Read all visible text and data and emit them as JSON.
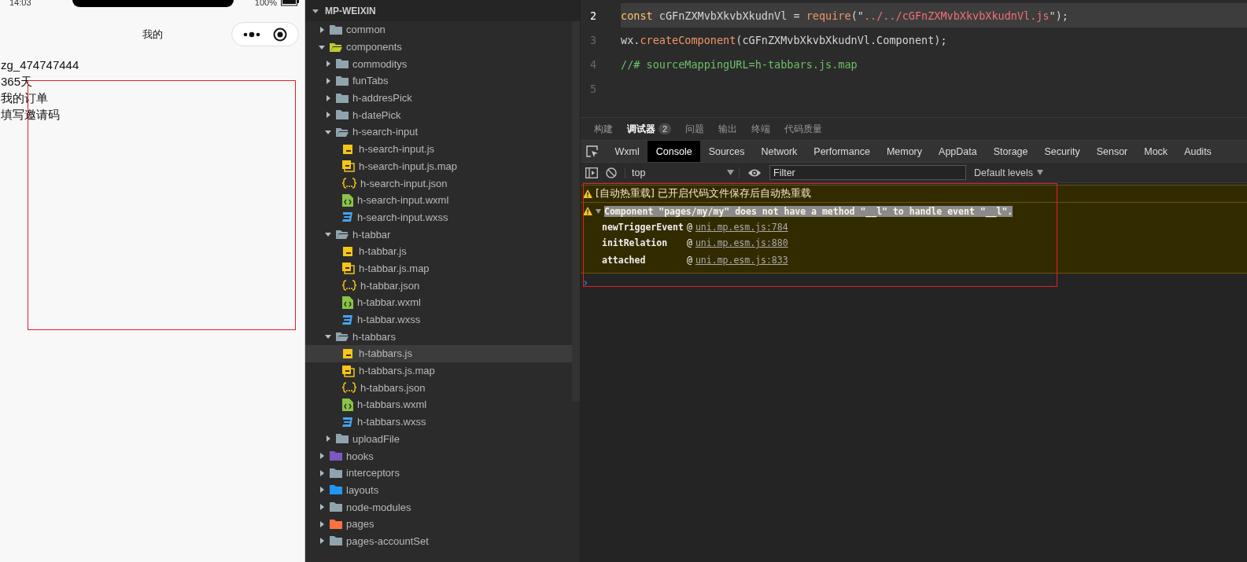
{
  "phone": {
    "status_bar": {
      "time": "14:03",
      "battery": "100%"
    },
    "nav_title": "我的",
    "lines": [
      "zg_474747444",
      "365天",
      "我的订单",
      "填写邀请码"
    ]
  },
  "explorer": {
    "title": "MP-WEIXIN",
    "expanded": true,
    "children": [
      {
        "name": "common",
        "kind": "folder",
        "color": "#90a4ae",
        "expanded": false,
        "selected": false
      },
      {
        "name": "components",
        "kind": "folder",
        "color": "#c0ca33",
        "expanded": true,
        "selected": false,
        "children": [
          {
            "name": "commoditys",
            "kind": "folder",
            "color": "#90a4ae",
            "expanded": false,
            "selected": false
          },
          {
            "name": "funTabs",
            "kind": "folder",
            "color": "#90a4ae",
            "expanded": false,
            "selected": false
          },
          {
            "name": "h-addresPick",
            "kind": "folder",
            "color": "#90a4ae",
            "expanded": false,
            "selected": false
          },
          {
            "name": "h-datePick",
            "kind": "folder",
            "color": "#90a4ae",
            "expanded": false,
            "selected": false
          },
          {
            "name": "h-search-input",
            "kind": "folder",
            "color": "#90a4ae",
            "expanded": true,
            "selected": false,
            "children": [
              {
                "name": "h-search-input.js",
                "kind": "js",
                "selected": false
              },
              {
                "name": "h-search-input.js.map",
                "kind": "map",
                "selected": false
              },
              {
                "name": "h-search-input.json",
                "kind": "json",
                "selected": false
              },
              {
                "name": "h-search-input.wxml",
                "kind": "wxml",
                "selected": false
              },
              {
                "name": "h-search-input.wxss",
                "kind": "wxss",
                "selected": false
              }
            ]
          },
          {
            "name": "h-tabbar",
            "kind": "folder",
            "color": "#90a4ae",
            "expanded": true,
            "selected": false,
            "children": [
              {
                "name": "h-tabbar.js",
                "kind": "js",
                "selected": false
              },
              {
                "name": "h-tabbar.js.map",
                "kind": "map",
                "selected": false
              },
              {
                "name": "h-tabbar.json",
                "kind": "json",
                "selected": false
              },
              {
                "name": "h-tabbar.wxml",
                "kind": "wxml",
                "selected": false
              },
              {
                "name": "h-tabbar.wxss",
                "kind": "wxss",
                "selected": false
              }
            ]
          },
          {
            "name": "h-tabbars",
            "kind": "folder",
            "color": "#90a4ae",
            "expanded": true,
            "selected": false,
            "children": [
              {
                "name": "h-tabbars.js",
                "kind": "js",
                "selected": true
              },
              {
                "name": "h-tabbars.js.map",
                "kind": "map",
                "selected": false
              },
              {
                "name": "h-tabbars.json",
                "kind": "json",
                "selected": false
              },
              {
                "name": "h-tabbars.wxml",
                "kind": "wxml",
                "selected": false
              },
              {
                "name": "h-tabbars.wxss",
                "kind": "wxss",
                "selected": false
              }
            ]
          },
          {
            "name": "uploadFile",
            "kind": "folder",
            "color": "#90a4ae",
            "expanded": false,
            "selected": false
          }
        ]
      },
      {
        "name": "hooks",
        "kind": "folder",
        "color": "#7e57c2",
        "expanded": false,
        "selected": false
      },
      {
        "name": "interceptors",
        "kind": "folder",
        "color": "#90a4ae",
        "expanded": false,
        "selected": false
      },
      {
        "name": "layouts",
        "kind": "folder",
        "color": "#2196f3",
        "expanded": false,
        "selected": false
      },
      {
        "name": "node-modules",
        "kind": "folder",
        "color": "#90a4ae",
        "expanded": false,
        "selected": false
      },
      {
        "name": "pages",
        "kind": "folder",
        "color": "#ff7043",
        "expanded": false,
        "selected": false
      },
      {
        "name": "pages-accountSet",
        "kind": "folder",
        "color": "#90a4ae",
        "expanded": false,
        "selected": false
      }
    ]
  },
  "editor": {
    "lines": [
      {
        "number": "2",
        "current": true,
        "tokens": [
          {
            "kind": "keyword",
            "text": "const"
          },
          {
            "kind": "plain",
            "text": " cGFnZXMvbXkvbXkudnVl = "
          },
          {
            "kind": "call",
            "text": "require"
          },
          {
            "kind": "plain",
            "text": "(\""
          },
          {
            "kind": "string",
            "text": "../../cGFnZXMvbXkvbXkudnVl.js"
          },
          {
            "kind": "plain",
            "text": "\");"
          }
        ]
      },
      {
        "number": "3",
        "current": false,
        "tokens": [
          {
            "kind": "plain",
            "text": "wx."
          },
          {
            "kind": "call",
            "text": "createComponent"
          },
          {
            "kind": "plain",
            "text": "(cGFnZXMvbXkvbXkudnVl.Component);"
          }
        ]
      },
      {
        "number": "4",
        "current": false,
        "tokens": [
          {
            "kind": "comment",
            "text": "//# sourceMappingURL=h-tabbars.js.map"
          }
        ]
      },
      {
        "number": "5",
        "current": false
      }
    ]
  },
  "bottom_tabs": [
    {
      "label": "构建",
      "selected": false
    },
    {
      "label": "调试器",
      "selected": true,
      "badge": "2"
    },
    {
      "label": "问题",
      "selected": false
    },
    {
      "label": "输出",
      "selected": false
    },
    {
      "label": "终端",
      "selected": false
    },
    {
      "label": "代码质量",
      "selected": false
    }
  ],
  "devtools_tabs": [
    {
      "label": "Wxml",
      "selected": false
    },
    {
      "label": "Console",
      "selected": true
    },
    {
      "label": "Sources",
      "selected": false
    },
    {
      "label": "Network",
      "selected": false
    },
    {
      "label": "Performance",
      "selected": false
    },
    {
      "label": "Memory",
      "selected": false
    },
    {
      "label": "AppData",
      "selected": false
    },
    {
      "label": "Storage",
      "selected": false
    },
    {
      "label": "Security",
      "selected": false
    },
    {
      "label": "Sensor",
      "selected": false
    },
    {
      "label": "Mock",
      "selected": false
    },
    {
      "label": "Audits",
      "selected": false
    }
  ],
  "console_toolbar": {
    "context": "top",
    "filter": {
      "placeholder": "Filter"
    },
    "levels": "Default levels"
  },
  "console": {
    "messages": [
      {
        "kind": "warning",
        "text": "[自动热重载] 已开启代码文件保存后自动热重载"
      },
      {
        "kind": "warning",
        "expanded": true,
        "text": "Component \"pages/my/my\" does not have a method \"__l\" to handle event \"__l\".",
        "stack": [
          {
            "function": "newTriggerEvent",
            "at": "@",
            "link": "uni.mp.esm.js:784"
          },
          {
            "function": "initRelation",
            "at": "@",
            "link": "uni.mp.esm.js:880"
          },
          {
            "function": "attached",
            "at": "@",
            "link": "uni.mp.esm.js:833"
          }
        ]
      }
    ],
    "prompt": "›"
  }
}
